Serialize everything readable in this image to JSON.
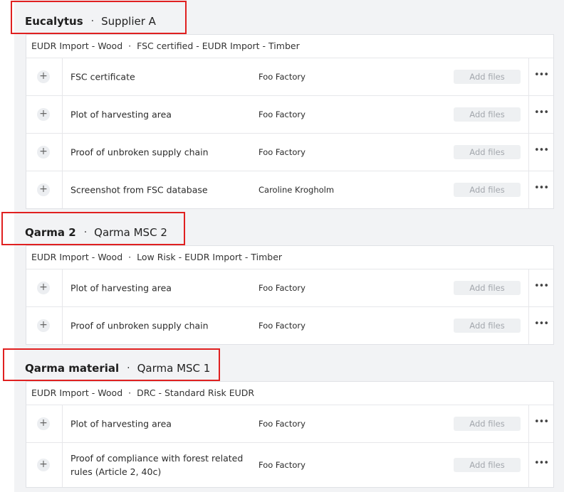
{
  "groups": [
    {
      "item": "Eucalytus",
      "supplier": "Supplier A",
      "card_title_left": "EUDR Import - Wood",
      "card_title_right": "FSC certified - EUDR Import - Timber",
      "rows": [
        {
          "document": "FSC certificate",
          "owner": "Foo Factory",
          "action": "Add files"
        },
        {
          "document": "Plot of harvesting area",
          "owner": "Foo Factory",
          "action": "Add files"
        },
        {
          "document": "Proof of unbroken supply chain",
          "owner": "Foo Factory",
          "action": "Add files"
        },
        {
          "document": "Screenshot from FSC database",
          "owner": "Caroline Krogholm",
          "action": "Add files"
        }
      ]
    },
    {
      "item": "Qarma 2",
      "supplier": "Qarma MSC 2",
      "card_title_left": "EUDR Import - Wood",
      "card_title_right": "Low Risk - EUDR Import - Timber",
      "rows": [
        {
          "document": "Plot of harvesting area",
          "owner": "Foo Factory",
          "action": "Add files"
        },
        {
          "document": "Proof of unbroken supply chain",
          "owner": "Foo Factory",
          "action": "Add files"
        }
      ]
    },
    {
      "item": "Qarma material",
      "supplier": "Qarma MSC 1",
      "card_title_left": "EUDR Import - Wood",
      "card_title_right": "DRC - Standard Risk EUDR",
      "rows": [
        {
          "document": "Plot of harvesting area",
          "owner": "Foo Factory",
          "action": "Add files"
        },
        {
          "document": "Proof of compliance with forest related rules (Article 2, 40c)",
          "owner": "Foo Factory",
          "action": "Add files"
        }
      ]
    }
  ],
  "icons": {
    "expand": "plus-icon",
    "menu": "more-horizontal-icon"
  },
  "colors": {
    "highlight": "#e02020",
    "panel_background": "#f2f3f5"
  }
}
